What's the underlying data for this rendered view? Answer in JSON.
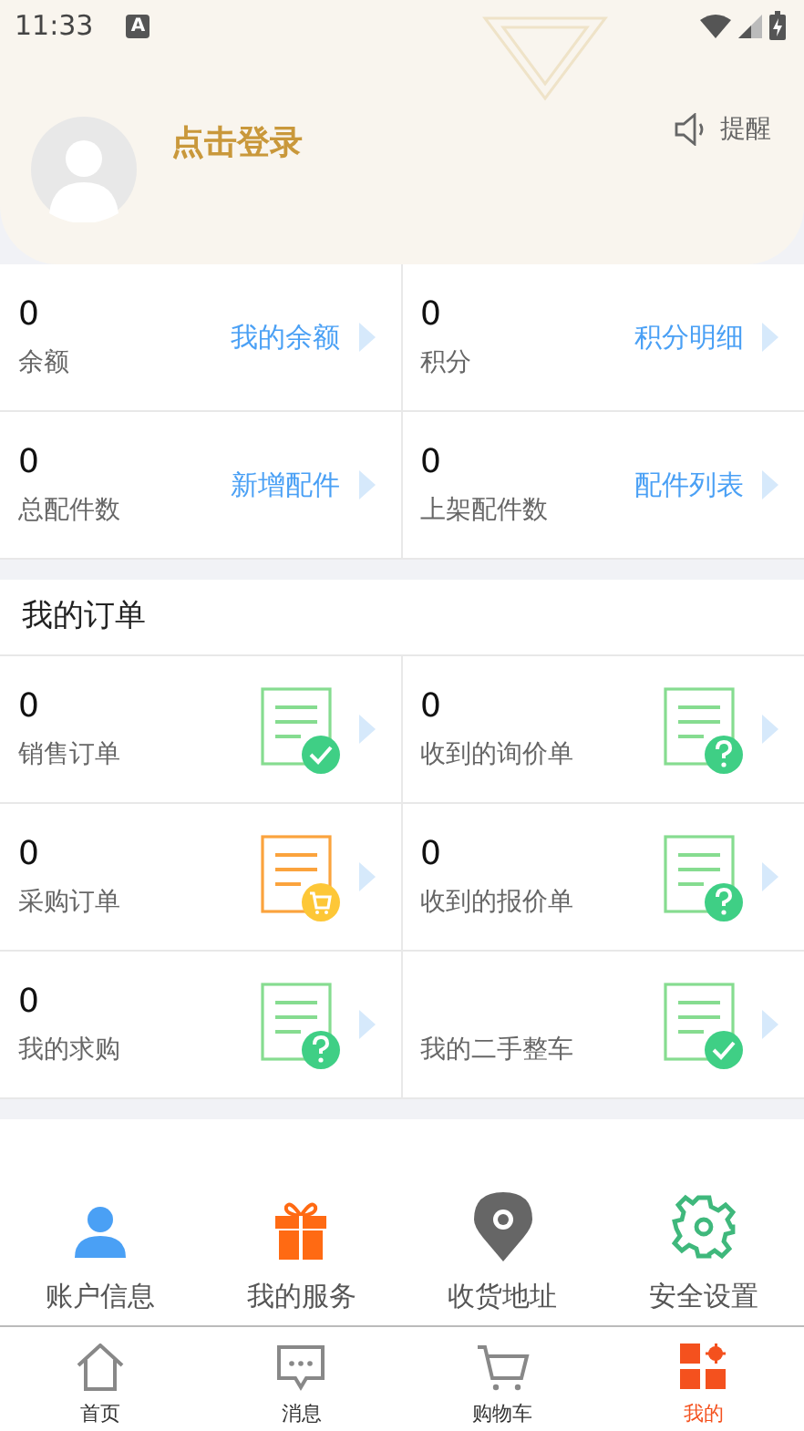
{
  "status_bar": {
    "time": "11:33",
    "notification": "A"
  },
  "profile": {
    "login": "点击登录",
    "reminder": "提醒"
  },
  "stats": [
    {
      "value": "0",
      "label": "余额",
      "link": "我的余额"
    },
    {
      "value": "0",
      "label": "积分",
      "link": "积分明细"
    },
    {
      "value": "0",
      "label": "总配件数",
      "link": "新增配件"
    },
    {
      "value": "0",
      "label": "上架配件数",
      "link": "配件列表"
    }
  ],
  "orders": {
    "title": "我的订单",
    "items": [
      {
        "value": "0",
        "label": "销售订单",
        "kind": "check"
      },
      {
        "value": "0",
        "label": "收到的询价单",
        "kind": "question"
      },
      {
        "value": "0",
        "label": "采购订单",
        "kind": "cart"
      },
      {
        "value": "0",
        "label": "收到的报价单",
        "kind": "question"
      },
      {
        "value": "0",
        "label": "我的求购",
        "kind": "question"
      },
      {
        "label": "我的二手整车",
        "kind": "check"
      }
    ]
  },
  "services": [
    {
      "label": "账户信息",
      "kind": "person"
    },
    {
      "label": "我的服务",
      "kind": "gift"
    },
    {
      "label": "收货地址",
      "kind": "pin"
    },
    {
      "label": "安全设置",
      "kind": "gear"
    }
  ],
  "tabs": [
    {
      "label": "首页",
      "kind": "home",
      "selected": false
    },
    {
      "label": "消息",
      "kind": "message",
      "selected": false
    },
    {
      "label": "购物车",
      "kind": "cart",
      "selected": false
    },
    {
      "label": "我的",
      "kind": "grid",
      "selected": true
    }
  ]
}
